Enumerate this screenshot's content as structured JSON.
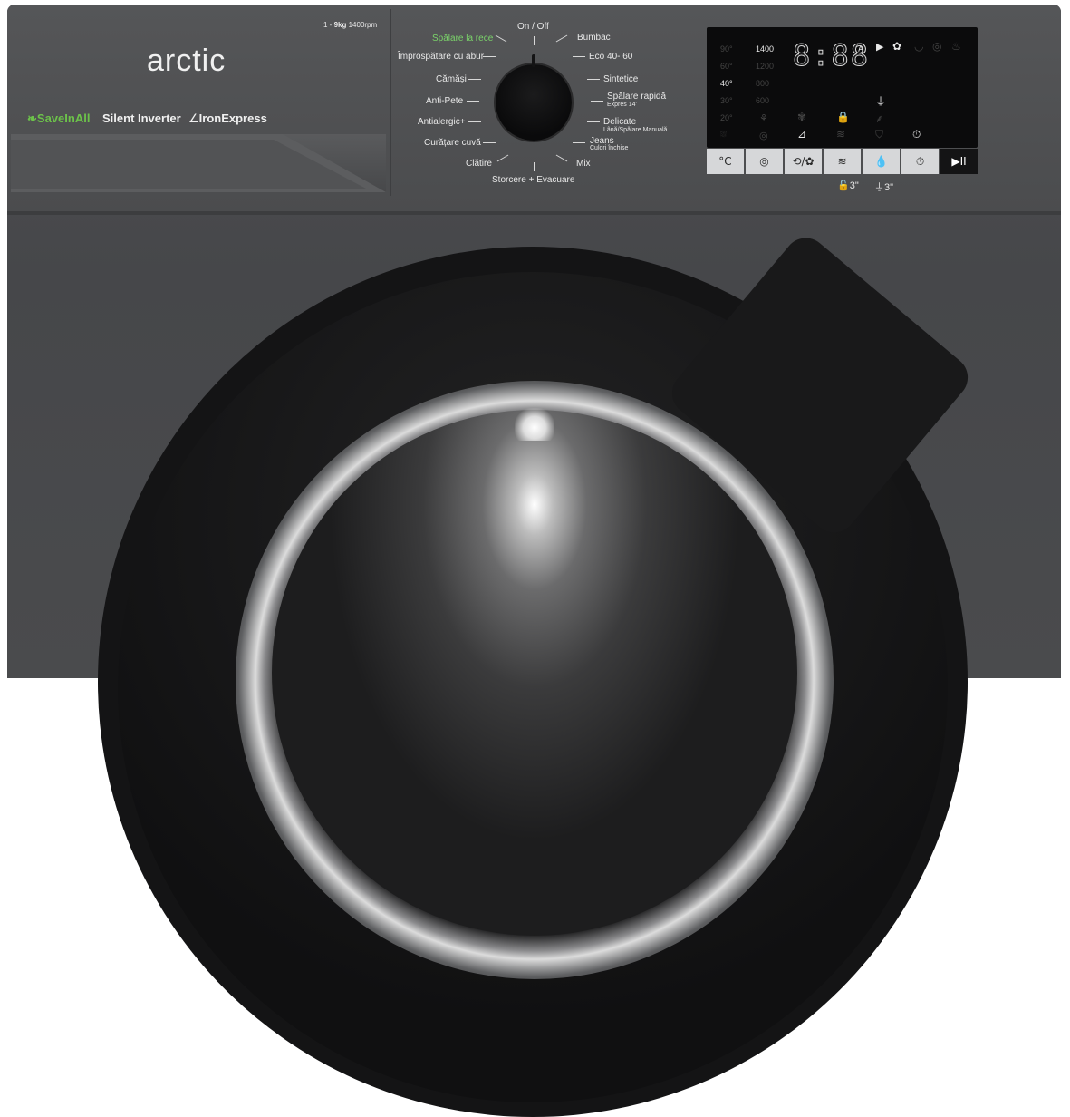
{
  "brand": {
    "logo": "arctic",
    "capacity_prefix": "1 - ",
    "capacity_value": "9kg",
    "spin": "1400rpm",
    "feature_1": "SaveInAll",
    "feature_2": "Silent Inverter",
    "feature_3": "IronExpress"
  },
  "dial": {
    "top": "On / Off",
    "left_programs": [
      "Spălare la rece",
      "Împrospătare cu abur",
      "Cămăși",
      "Anti-Pete",
      "Antialergic+",
      "Curățare cuvă",
      "Clătire"
    ],
    "right_programs": [
      "Bumbac",
      "Eco 40- 60",
      "Sintetice",
      "Spălare rapidă",
      "Delicate",
      "Jeans",
      "Mix"
    ],
    "right_sub": {
      "quick": "Expres 14'",
      "delicate": "Lână/Spălare Manuală",
      "jeans": "Culori închise"
    },
    "bottom": "Storcere + Evacuare",
    "selected_color": "#7bd36a"
  },
  "display": {
    "temps": [
      "90°",
      "60°",
      "40°",
      "30°",
      "20°"
    ],
    "speeds": [
      "1400",
      "1200",
      "800",
      "600"
    ],
    "time": "8:88"
  },
  "buttons": [
    "°C",
    "◎",
    "⟲/✿",
    "≋",
    "💧",
    "⏱",
    "▶II"
  ],
  "below_buttons": [
    "🔓3\"",
    "⏚3\""
  ]
}
